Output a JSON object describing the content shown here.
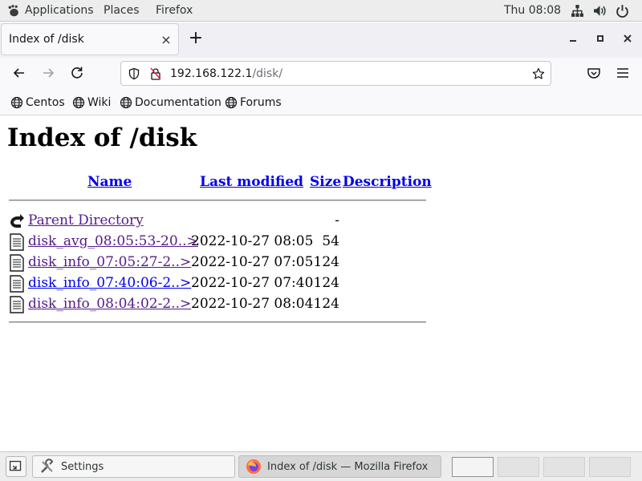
{
  "topbar": {
    "applications_label": "Applications",
    "places_label": "Places",
    "firefox_label": "Firefox",
    "clock": "Thu 08:08",
    "icons": [
      "network-icon",
      "volume-icon",
      "power-icon"
    ]
  },
  "browser": {
    "tab_title": "Index of /disk",
    "url_host": "192.168.122.1",
    "url_path": "/disk/",
    "bookmarks": [
      {
        "label": "Centos",
        "icon": "globe-icon"
      },
      {
        "label": "Wiki",
        "icon": "globe-icon"
      },
      {
        "label": "Documentation",
        "icon": "globe-icon"
      },
      {
        "label": "Forums",
        "icon": "globe-icon"
      }
    ]
  },
  "page": {
    "heading": "Index of /disk",
    "columns": {
      "name": "Name",
      "last_modified": "Last modified",
      "size": "Size",
      "description": "Description"
    },
    "rows": [
      {
        "name": "Parent Directory",
        "date": "",
        "size": "-",
        "icon": "back-folder-icon",
        "visited": true
      },
      {
        "name": "disk_avg_08:05:53-20..>",
        "date": "2022-10-27 08:05",
        "size": "54",
        "icon": "file-icon",
        "visited": true
      },
      {
        "name": "disk_info_07:05:27-2..>",
        "date": "2022-10-27 07:05",
        "size": "124",
        "icon": "file-icon",
        "visited": true
      },
      {
        "name": "disk_info_07:40:06-2..>",
        "date": "2022-10-27 07:40",
        "size": "124",
        "icon": "file-icon",
        "visited": false
      },
      {
        "name": "disk_info_08:04:02-2..>",
        "date": "2022-10-27 08:04",
        "size": "124",
        "icon": "file-icon",
        "visited": true
      }
    ]
  },
  "taskbar": {
    "tasks": [
      {
        "label": "Settings",
        "icon": "settings-icon",
        "active": false
      },
      {
        "label": "Index of /disk — Mozilla Firefox",
        "icon": "firefox-icon",
        "active": true
      }
    ],
    "workspaces": 4,
    "active_workspace": 1
  },
  "colors": {
    "link": "#0000ee",
    "visited_link": "#551a8b",
    "panel": "#ededed",
    "chrome": "#f9f9fb"
  }
}
